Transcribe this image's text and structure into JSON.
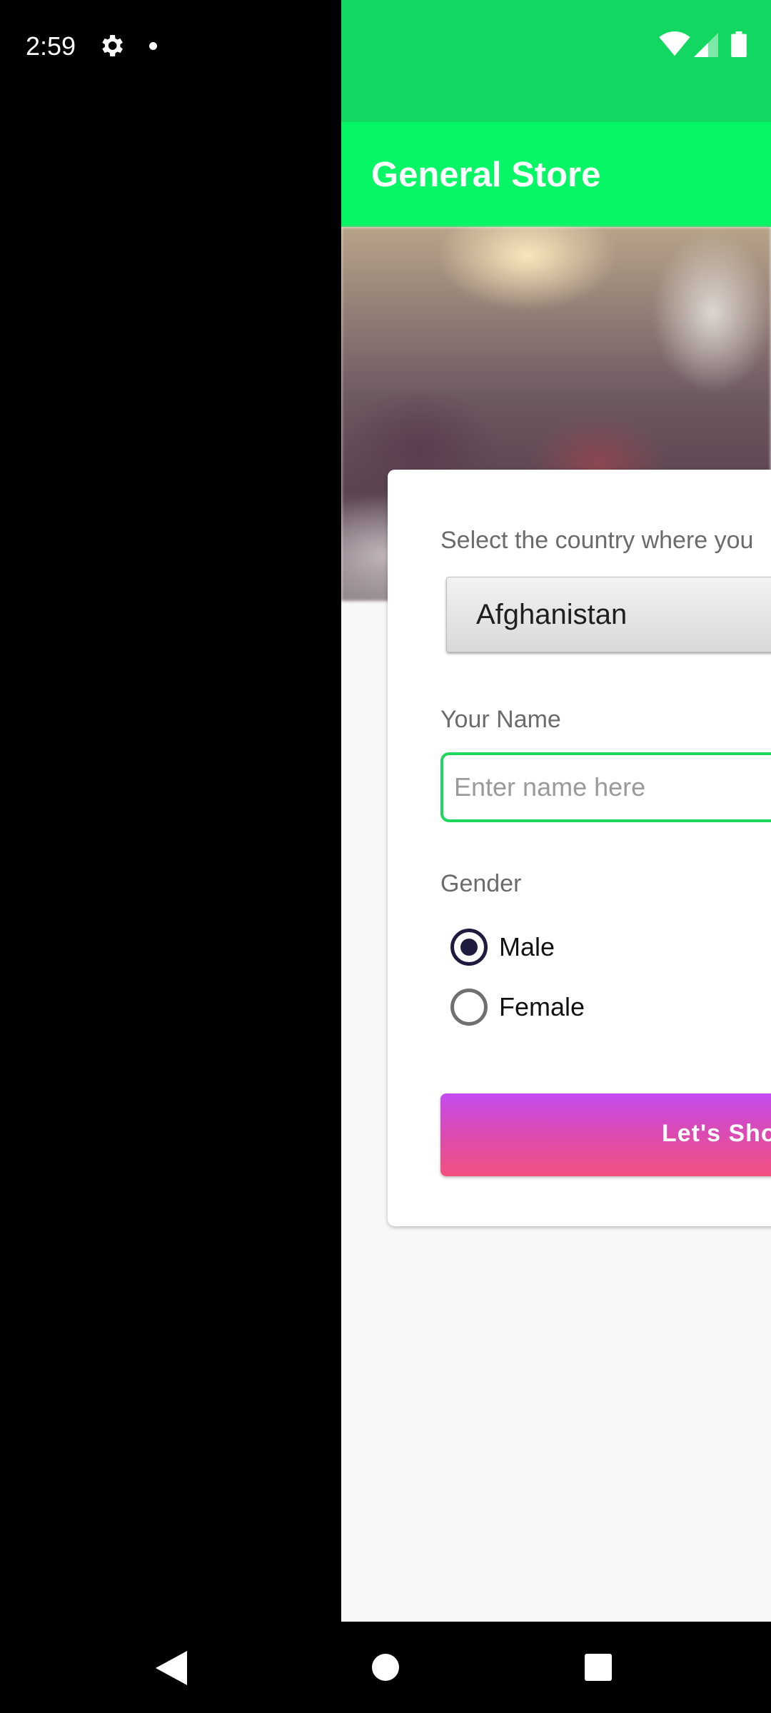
{
  "status_bar": {
    "time": "2:59"
  },
  "app": {
    "title": "General Store",
    "colors": {
      "status_bar": "#12d862",
      "toolbar": "#05f765",
      "input_border": "#1ed760",
      "button_gradient_top": "#c44bf0",
      "button_gradient_bottom": "#f4517e"
    }
  },
  "form": {
    "country_label": "Select the country where you",
    "country_selected": "Afghanistan",
    "name_label": "Your Name",
    "name_placeholder": "Enter name here",
    "name_value": "",
    "gender_label": "Gender",
    "gender_options": [
      {
        "label": "Male",
        "checked": true
      },
      {
        "label": "Female",
        "checked": false
      }
    ],
    "submit_label": "Let's  Sho"
  },
  "nav_bar": {
    "icons": [
      "back-icon",
      "home-icon",
      "recents-icon"
    ]
  }
}
